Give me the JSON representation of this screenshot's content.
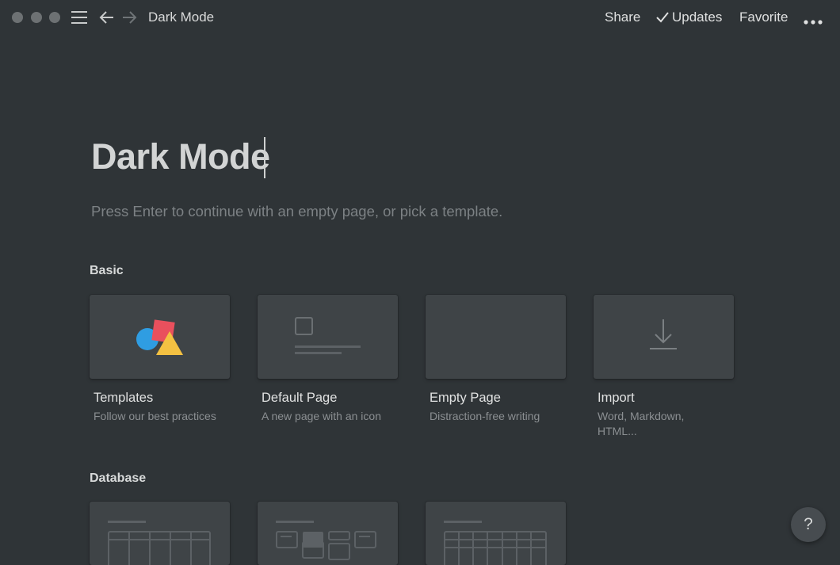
{
  "window": {
    "breadcrumb": "Dark Mode",
    "actions": {
      "share": "Share",
      "updates": "Updates",
      "favorite": "Favorite"
    }
  },
  "page": {
    "title": "Dark Mode",
    "hint": "Press Enter to continue with an empty page, or pick a template."
  },
  "sections": {
    "basic": {
      "label": "Basic",
      "cards": [
        {
          "title": "Templates",
          "desc": "Follow our best practices",
          "icon": "templates-shapes-icon"
        },
        {
          "title": "Default Page",
          "desc": "A new page with an icon",
          "icon": "default-page-icon"
        },
        {
          "title": "Empty Page",
          "desc": "Distraction-free writing",
          "icon": ""
        },
        {
          "title": "Import",
          "desc": "Word, Markdown, HTML...",
          "icon": "download-icon"
        }
      ]
    },
    "database": {
      "label": "Database",
      "cards": [
        {
          "icon": "table-icon"
        },
        {
          "icon": "board-icon"
        },
        {
          "icon": "calendar-icon"
        }
      ]
    }
  },
  "help": {
    "label": "?"
  },
  "colors": {
    "background": "#2f3437",
    "card": "#3f4447",
    "red": "#e9505d",
    "blue": "#2f9de2",
    "yellow": "#f4c142"
  }
}
